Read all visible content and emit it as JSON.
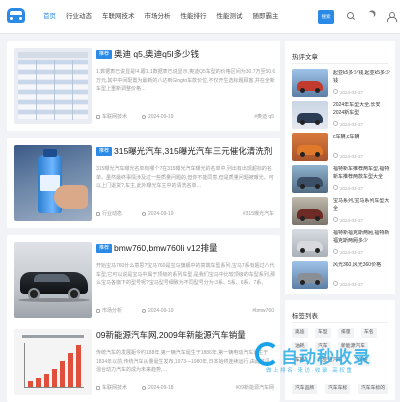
{
  "header": {
    "nav": [
      "首页",
      "行业动态",
      "车联网技术",
      "市场分析",
      "性能排行",
      "性能测试",
      "随即霸主"
    ],
    "search_button": "搜索"
  },
  "articles": [
    {
      "badge": "推荐",
      "title": "奥迪 q5,奥迪q5l多少钱",
      "excerpt": "1.数据表已说显是!4.跟1.1数据表已说显示,奥迪Q5车型的价格区间为30.7万至50.6万元,其中中间配置为最新的八达到Gingto车款价位,不仅开生选标题顾客,并在全新车型上重新调整价格…",
      "category": "车联网技术",
      "date": "2024-09-19",
      "tag": "#奥迪 q5"
    },
    {
      "badge": "推荐",
      "title": "315曝光汽车,315曝光汽车三元催化清洗剂",
      "excerpt": "315曝光汽车曝光名单有哪个?在315曝光汽车曝光的名单中,列出有出现超标的名单。虽然最终事情涉及过一些质量问题的,但你不能同意,但是质量问题被曝光。可以上门退货?,车主,此外曝光车主中的清洗名单…",
      "category": "行业动态",
      "date": "2024-09-19",
      "tag": "#315曝光汽车"
    },
    {
      "badge": "推荐",
      "title": "bmw760,bmw760li v12排量",
      "excerpt": "开始宝马760什么意思?宝马760是宝马旗舰中的高端车型系列,宝马7系有超过八代车型,它可以说是宝马中属于顶级的系列车型,是我们宝马中比较顶级的车型系列,那么宝马各旗下的型号呢?宝马型号细致为不同型号分为:3系、5系、6系、7系、X1、X3、X5、2480M等…",
      "category": "市场分析",
      "date": "2024-09-19",
      "tag": "#bmw760"
    },
    {
      "badge": "",
      "title": "09新能源汽车网,2009年新能源汽车销量",
      "excerpt": "传统汽车的发展距今约188年,第一辆汽车诞生于1886年,第一辆电动汽车诞生于1834年以前,传统汽车从量诞生发布,1973—1980年,日本始终连续运行,由此可见,混合动力汽车的成为未来趋势,…",
      "category": "车联网技术",
      "date": "2024-09-18",
      "tag": "#09新能源汽车网"
    }
  ],
  "sidebar": {
    "hot_title": "热评文章",
    "hot": [
      {
        "title": "起亚k5多少钱,起亚k5多少钱",
        "date": "2024-03-27"
      },
      {
        "title": "2024年车型大全,长安2024新车型",
        "date": "2024-03-27"
      },
      {
        "title": "c车辆,c车辆",
        "date": "2024-03-27"
      },
      {
        "title": "福特新车推荐两车型,福特新车推荐两款车型大全",
        "date": "2024-03-27"
      },
      {
        "title": "宝马系列,宝马系列车型大全",
        "date": "2024-03-27"
      },
      {
        "title": "福特新福克斯两厢,福特新福克斯两厢多少",
        "date": "2024-03-27"
      },
      {
        "title": "风光360,风光360价格",
        "date": "2024-03-27"
      }
    ],
    "tags_title": "标签列表",
    "tags": [
      "奥迪",
      "车型",
      "排量",
      "车名",
      "油耗",
      "汽车",
      "新能源汽车",
      "车辆",
      "比亚迪汽车",
      "价格",
      "汽车品牌",
      "汽车车标",
      "汽车车标的"
    ]
  },
  "watermark": {
    "text": "自动秒收录",
    "sub": "做 上 排 名 · 来 访 · 收 录 · 高 权 重"
  }
}
